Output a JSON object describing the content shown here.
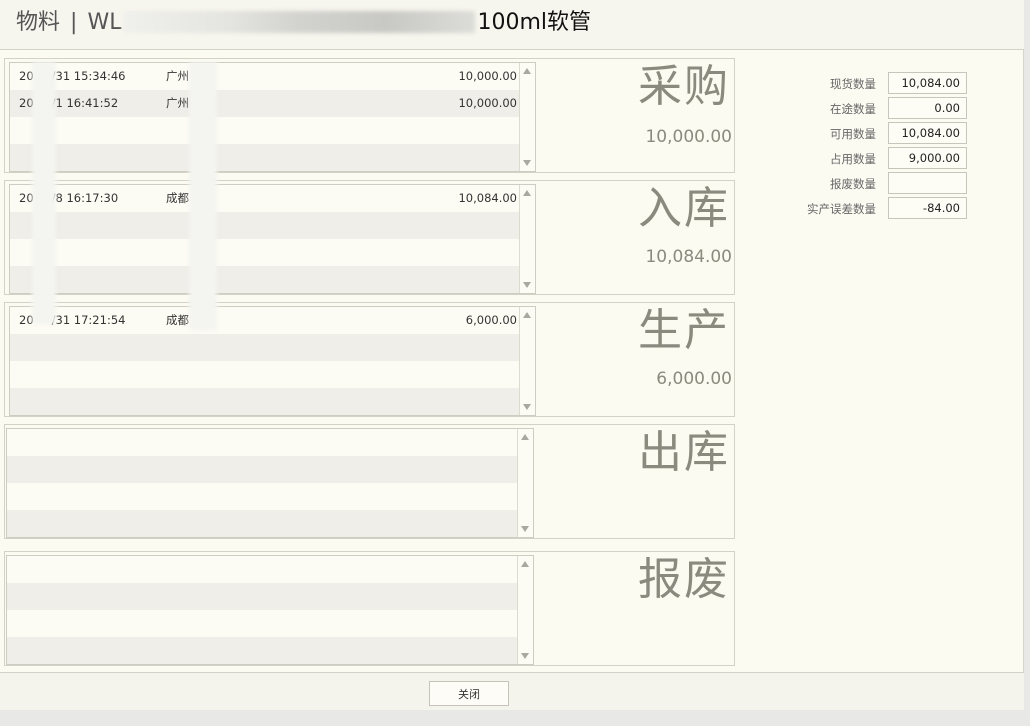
{
  "header": {
    "title_prefix": "物料",
    "title_separator": "|",
    "title_code": "WL",
    "title_name": "100ml软管"
  },
  "panels": [
    {
      "title": "采购",
      "total": "10,000.00",
      "rows": [
        {
          "date": "20",
          "date_tail": "/31 15:34:46",
          "org": "广州",
          "qty": "10,000.00"
        },
        {
          "date": "20",
          "date_tail": "/1 16:41:52",
          "org": "广州",
          "qty": "10,000.00"
        }
      ]
    },
    {
      "title": "入库",
      "total": "10,084.00",
      "rows": [
        {
          "date": "20",
          "date_tail": "/8 16:17:30",
          "org": "成都",
          "qty": "10,084.00"
        }
      ]
    },
    {
      "title": "生产",
      "total": "6,000.00",
      "rows": [
        {
          "date": "20",
          "date_tail": "/31 17:21:54",
          "org": "成都",
          "qty": "6,000.00"
        }
      ]
    },
    {
      "title": "出库",
      "total": "",
      "rows": []
    },
    {
      "title": "报废",
      "total": "",
      "rows": []
    }
  ],
  "stats": [
    {
      "label": "现货数量",
      "value": "10,084.00"
    },
    {
      "label": "在途数量",
      "value": "0.00"
    },
    {
      "label": "可用数量",
      "value": "10,084.00"
    },
    {
      "label": "占用数量",
      "value": "9,000.00"
    },
    {
      "label": "报废数量",
      "value": ""
    },
    {
      "label": "实产误差数量",
      "value": "-84.00"
    }
  ],
  "footer": {
    "close_label": "关闭"
  }
}
